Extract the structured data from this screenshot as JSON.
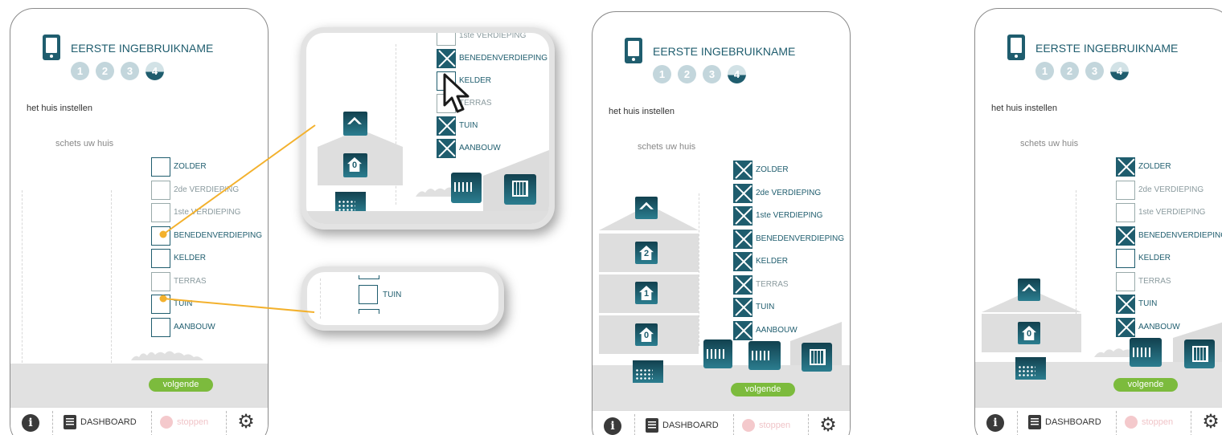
{
  "screen": {
    "title": "EERSTE INGEBRUIKNAME",
    "steps": [
      "1",
      "2",
      "3",
      "4"
    ],
    "subtitle": "het huis instellen",
    "instruction": "schets uw huis",
    "next_button": "volgende"
  },
  "floors": [
    {
      "label": "ZOLDER"
    },
    {
      "label": "2de VERDIEPING"
    },
    {
      "label": "1ste VERDIEPING"
    },
    {
      "label": "BENEDENVERDIEPING"
    },
    {
      "label": "KELDER"
    },
    {
      "label": "TERRAS"
    },
    {
      "label": "TUIN"
    },
    {
      "label": "AANBOUW"
    }
  ],
  "bottom_bar": {
    "info_icon": "i",
    "dashboard_label": "DASHBOARD",
    "stop_label": "stoppen",
    "gear_icon": "⚙"
  },
  "phone1": {
    "checked": [
      false,
      false,
      false,
      false,
      false,
      false,
      false,
      false
    ]
  },
  "phone2": {
    "checked": [
      true,
      true,
      true,
      true,
      true,
      true,
      true,
      true
    ],
    "floor_numbers": [
      "2",
      "1",
      "0"
    ]
  },
  "phone3": {
    "checked": [
      true,
      false,
      false,
      true,
      false,
      false,
      true,
      true
    ],
    "floor_numbers": [
      "0"
    ]
  },
  "zoom_callout": {
    "items": [
      {
        "label": "1ste VERDIEPING",
        "checked": false
      },
      {
        "label": "BENEDENVERDIEPING",
        "checked": true
      },
      {
        "label": "KELDER",
        "checked": false
      },
      {
        "label": "TERRAS",
        "checked": false
      },
      {
        "label": "TUIN",
        "checked": true
      },
      {
        "label": "AANBOUW",
        "checked": true
      }
    ],
    "floor_number": "0"
  },
  "tuin_callout": {
    "label": "TUIN"
  },
  "colors": {
    "accent": "#1f5d6e",
    "next_button": "#7cbb3d",
    "connector": "#f3b12d",
    "stop": "#f4c9cc"
  }
}
